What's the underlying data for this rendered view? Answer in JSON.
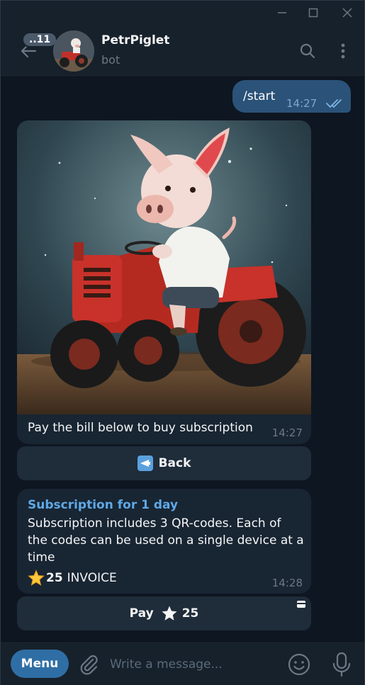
{
  "header": {
    "unread_count": "..11",
    "chat_title": "PetrPiglet",
    "chat_status": "bot"
  },
  "messages": {
    "outgoing": {
      "text": "/start",
      "time": "14:27"
    },
    "photo_message": {
      "caption": "Pay the bill below to buy subscription",
      "time": "14:27"
    },
    "back_button_label": "Back",
    "invoice": {
      "title": "Subscription for 1 day",
      "description": "Subscription includes 3 QR-codes. Each of the codes can be used on a single device at a time",
      "amount": "25",
      "amount_label": "INVOICE",
      "time": "14:28"
    },
    "pay_button": {
      "label": "Pay",
      "amount": "25"
    }
  },
  "composer": {
    "menu_label": "Menu",
    "placeholder": "Write a message..."
  },
  "colors": {
    "background": "#0e1621",
    "panel": "#17212b",
    "incoming_bubble": "#182533",
    "outgoing_bubble": "#2b5278",
    "accent": "#5fa8e6",
    "menu_button": "#2f6ea5"
  },
  "icons": {
    "back": "arrow-left-icon",
    "search": "search-icon",
    "more": "more-vertical-icon",
    "attach": "paperclip-icon",
    "emoji": "smiley-icon",
    "mic": "microphone-icon",
    "star": "star-icon",
    "read": "double-check-icon"
  }
}
